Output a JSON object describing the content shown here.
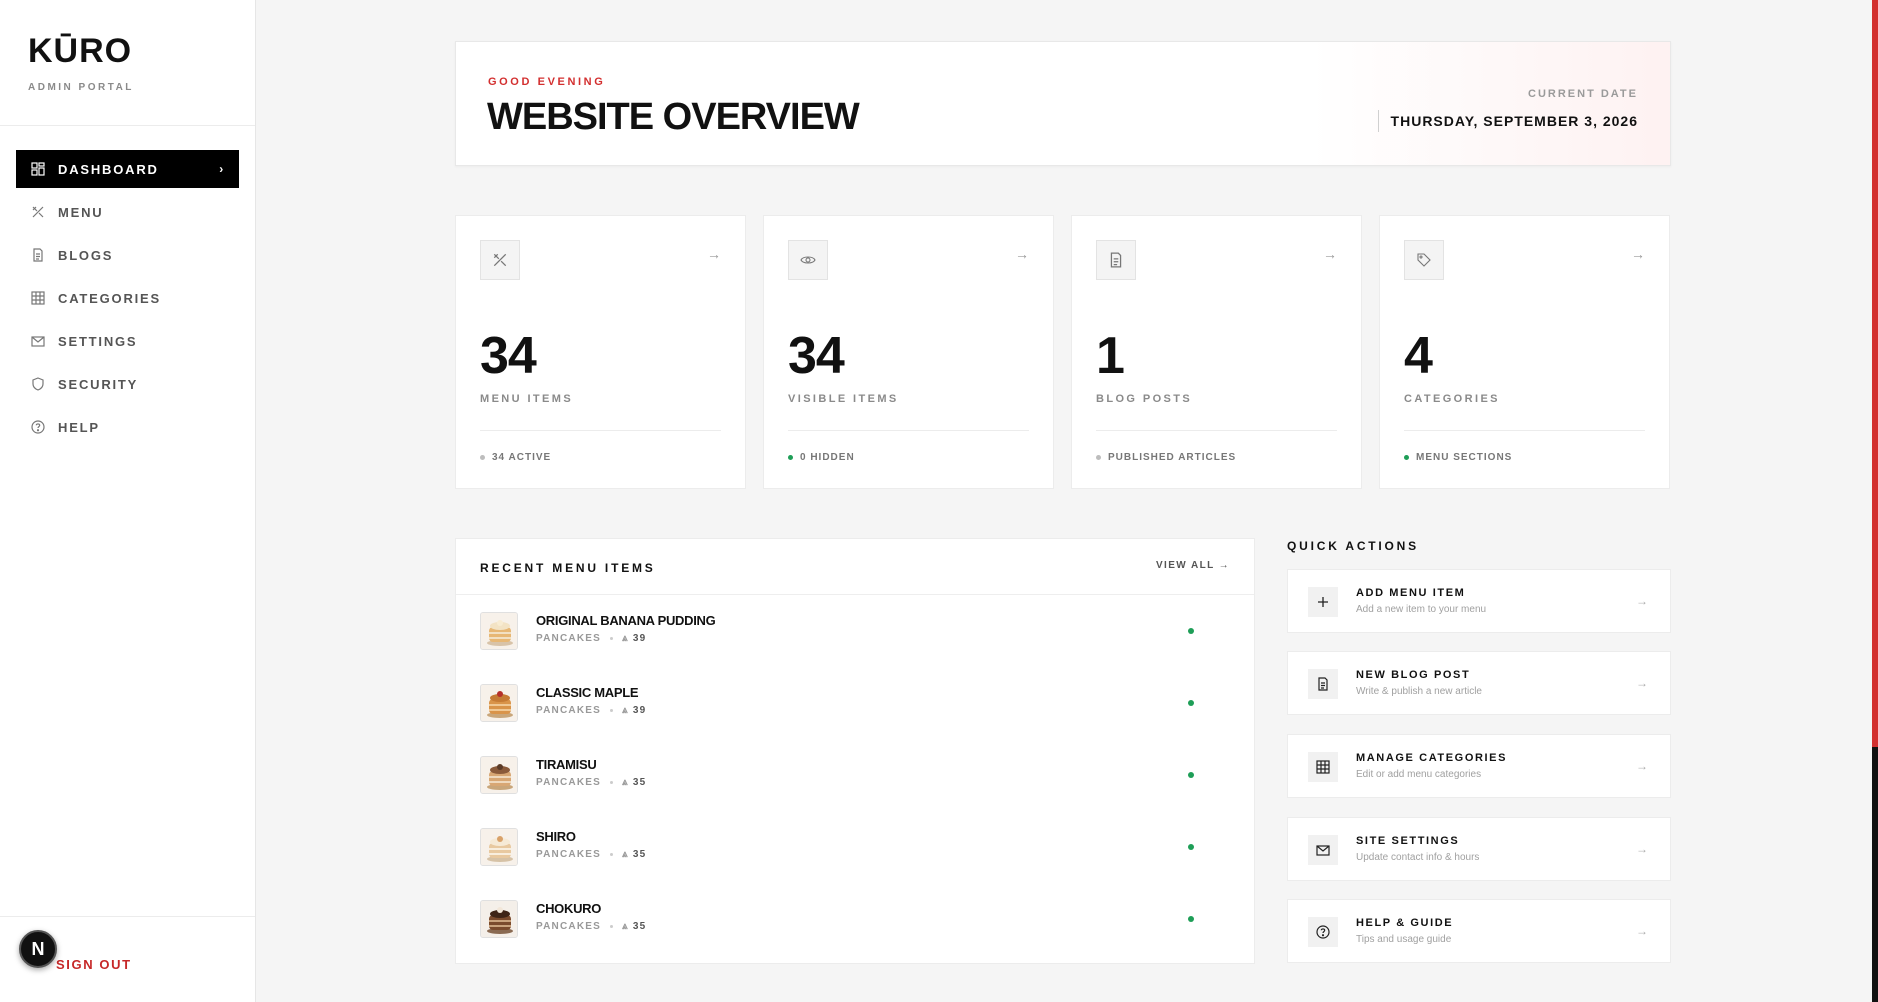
{
  "brand": {
    "logo": "KŪRO",
    "subtitle": "ADMIN PORTAL"
  },
  "nav": [
    {
      "label": "DASHBOARD",
      "icon": "dashboard-icon",
      "active": true
    },
    {
      "label": "MENU",
      "icon": "utensils-icon"
    },
    {
      "label": "BLOGS",
      "icon": "document-icon"
    },
    {
      "label": "CATEGORIES",
      "icon": "grid-icon"
    },
    {
      "label": "SETTINGS",
      "icon": "mail-icon"
    },
    {
      "label": "SECURITY",
      "icon": "shield-icon"
    },
    {
      "label": "HELP",
      "icon": "help-circle-icon"
    }
  ],
  "sign_out": "SIGN OUT",
  "dev_badge": "N",
  "hero": {
    "greeting": "GOOD EVENING",
    "title": "WEBSITE OVERVIEW",
    "date_label": "CURRENT DATE",
    "date_value": "THURSDAY, SEPTEMBER 3, 2026"
  },
  "stats": [
    {
      "value": "34",
      "label": "MENU ITEMS",
      "sub": "34 ACTIVE",
      "icon": "utensils-icon",
      "dot_color": "#bdbdbd"
    },
    {
      "value": "34",
      "label": "VISIBLE ITEMS",
      "sub": "0 HIDDEN",
      "icon": "eye-icon",
      "dot_color": "#1e9e57"
    },
    {
      "value": "1",
      "label": "BLOG POSTS",
      "sub": "PUBLISHED ARTICLES",
      "icon": "document-icon",
      "dot_color": "#bdbdbd"
    },
    {
      "value": "4",
      "label": "CATEGORIES",
      "sub": "MENU SECTIONS",
      "icon": "tag-icon",
      "dot_color": "#1e9e57"
    }
  ],
  "recent": {
    "title": "RECENT MENU ITEMS",
    "view_all": "VIEW ALL",
    "items": [
      {
        "name": "ORIGINAL BANANA PUDDING",
        "category": "PANCAKES",
        "count": "39"
      },
      {
        "name": "CLASSIC MAPLE",
        "category": "PANCAKES",
        "count": "39"
      },
      {
        "name": "TIRAMISU",
        "category": "PANCAKES",
        "count": "35"
      },
      {
        "name": "SHIRO",
        "category": "PANCAKES",
        "count": "35"
      },
      {
        "name": "CHOKURO",
        "category": "PANCAKES",
        "count": "35"
      }
    ]
  },
  "quick_actions": {
    "title": "QUICK ACTIONS",
    "items": [
      {
        "title": "ADD MENU ITEM",
        "subtitle": "Add a new item to your menu",
        "icon": "plus-icon"
      },
      {
        "title": "NEW BLOG POST",
        "subtitle": "Write & publish a new article",
        "icon": "document-icon"
      },
      {
        "title": "MANAGE CATEGORIES",
        "subtitle": "Edit or add menu categories",
        "icon": "grid-icon"
      },
      {
        "title": "SITE SETTINGS",
        "subtitle": "Update contact info & hours",
        "icon": "mail-icon"
      },
      {
        "title": "HELP & GUIDE",
        "subtitle": "Tips and usage guide",
        "icon": "help-circle-icon"
      }
    ]
  },
  "colors": {
    "accent": "#d32f2f",
    "active_dot": "#1e9e57",
    "nav_active_bg": "#000000"
  }
}
